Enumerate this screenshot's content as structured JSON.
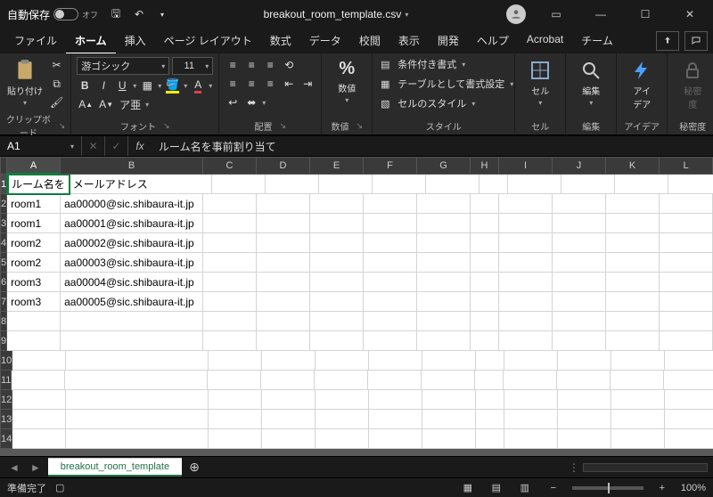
{
  "titlebar": {
    "autosave_label": "自動保存",
    "autosave_state": "オフ",
    "filename": "breakout_room_template.csv",
    "save_icon": "save-icon",
    "undo_icon": "undo-icon",
    "redo_icon": "redo-icon"
  },
  "menu": {
    "tabs": [
      "ファイル",
      "ホーム",
      "挿入",
      "ページ レイアウト",
      "数式",
      "データ",
      "校閲",
      "表示",
      "開発",
      "ヘルプ",
      "Acrobat",
      "チーム"
    ]
  },
  "ribbon": {
    "clipboard": {
      "paste": "貼り付け",
      "label": "クリップボード"
    },
    "font": {
      "name": "游ゴシック",
      "size": "11",
      "label": "フォント",
      "bold": "B",
      "italic": "I",
      "underline": "U"
    },
    "align": {
      "label": "配置"
    },
    "number": {
      "btn": "数値",
      "pct": "%",
      "label": "数値"
    },
    "styles": {
      "cond": "条件付き書式",
      "table": "テーブルとして書式設定",
      "cell": "セルのスタイル",
      "label": "スタイル"
    },
    "cells": {
      "btn": "セル",
      "label": "セル"
    },
    "editing": {
      "btn": "編集",
      "label": "編集"
    },
    "ideas": {
      "btn": "アイ\nデア",
      "label": "アイデア"
    },
    "sensitivity": {
      "btn": "秘密\n度",
      "label": "秘密度"
    }
  },
  "formula": {
    "namebox": "A1",
    "content": "ルーム名を事前割り当て"
  },
  "grid": {
    "columns": [
      "A",
      "B",
      "C",
      "D",
      "E",
      "F",
      "G",
      "H",
      "I",
      "J",
      "K",
      "L"
    ],
    "col_widths": [
      "",
      "wide",
      "",
      "",
      "",
      "",
      "",
      "narrow",
      "",
      "",
      "",
      ""
    ],
    "rows": 14,
    "active": {
      "row": 1,
      "col": 1
    },
    "data": [
      [
        "ルーム名を",
        "メールアドレス",
        "",
        "",
        "",
        "",
        "",
        "",
        "",
        "",
        "",
        ""
      ],
      [
        "room1",
        "aa00000@sic.shibaura-it.jp",
        "",
        "",
        "",
        "",
        "",
        "",
        "",
        "",
        "",
        ""
      ],
      [
        "room1",
        "aa00001@sic.shibaura-it.jp",
        "",
        "",
        "",
        "",
        "",
        "",
        "",
        "",
        "",
        ""
      ],
      [
        "room2",
        "aa00002@sic.shibaura-it.jp",
        "",
        "",
        "",
        "",
        "",
        "",
        "",
        "",
        "",
        ""
      ],
      [
        "room2",
        "aa00003@sic.shibaura-it.jp",
        "",
        "",
        "",
        "",
        "",
        "",
        "",
        "",
        "",
        ""
      ],
      [
        "room3",
        "aa00004@sic.shibaura-it.jp",
        "",
        "",
        "",
        "",
        "",
        "",
        "",
        "",
        "",
        ""
      ],
      [
        "room3",
        "aa00005@sic.shibaura-it.jp",
        "",
        "",
        "",
        "",
        "",
        "",
        "",
        "",
        "",
        ""
      ],
      [
        "",
        "",
        "",
        "",
        "",
        "",
        "",
        "",
        "",
        "",
        "",
        ""
      ],
      [
        "",
        "",
        "",
        "",
        "",
        "",
        "",
        "",
        "",
        "",
        "",
        ""
      ],
      [
        "",
        "",
        "",
        "",
        "",
        "",
        "",
        "",
        "",
        "",
        "",
        ""
      ],
      [
        "",
        "",
        "",
        "",
        "",
        "",
        "",
        "",
        "",
        "",
        "",
        ""
      ],
      [
        "",
        "",
        "",
        "",
        "",
        "",
        "",
        "",
        "",
        "",
        "",
        ""
      ],
      [
        "",
        "",
        "",
        "",
        "",
        "",
        "",
        "",
        "",
        "",
        "",
        ""
      ],
      [
        "",
        "",
        "",
        "",
        "",
        "",
        "",
        "",
        "",
        "",
        "",
        ""
      ]
    ],
    "a1_full": "ルーム名を事前割り当て"
  },
  "sheet": {
    "name": "breakout_room_template"
  },
  "status": {
    "ready": "準備完了",
    "zoom": "100%"
  }
}
